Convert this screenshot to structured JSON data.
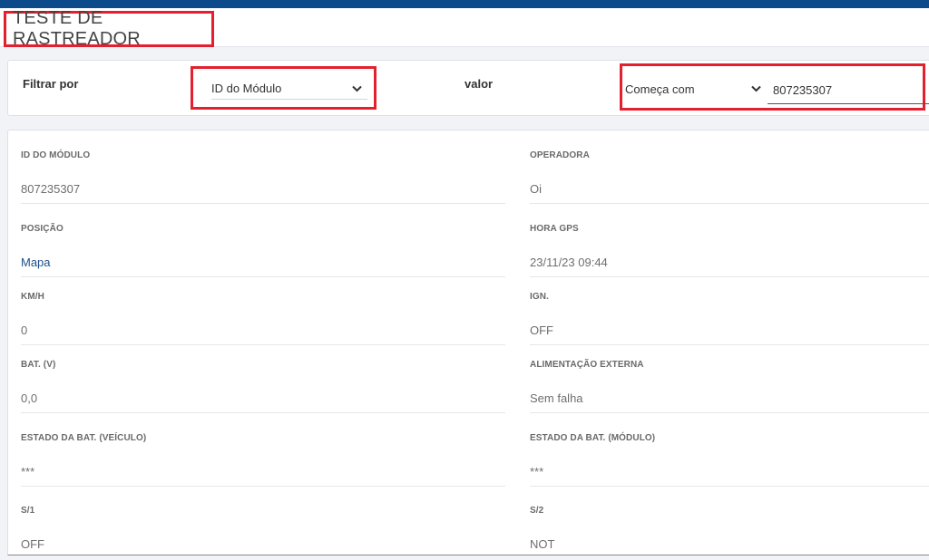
{
  "header": {
    "title": "TESTE DE RASTREADOR"
  },
  "filter": {
    "filter_label": "Filtrar por",
    "filter_select": "ID do Módulo",
    "value_label": "valor",
    "match_select": "Começa com",
    "value_input": "807235307"
  },
  "details": {
    "module_id": {
      "label": "ID DO MÓDULO",
      "value": "807235307"
    },
    "carrier": {
      "label": "OPERADORA",
      "value": "Oi"
    },
    "position": {
      "label": "POSIÇÃO",
      "value": "Mapa"
    },
    "gps_time": {
      "label": "HORA GPS",
      "value": "23/11/23 09:44"
    },
    "speed": {
      "label": "KM/H",
      "value": "0"
    },
    "ignition": {
      "label": "IGN.",
      "value": "OFF"
    },
    "battery": {
      "label": "BAT. (V)",
      "value": "0,0"
    },
    "external_power": {
      "label": "ALIMENTAÇÃO EXTERNA",
      "value": "Sem falha"
    },
    "vehicle_battery_state": {
      "label": "ESTADO DA BAT. (VEÍCULO)",
      "value": "***"
    },
    "module_battery_state": {
      "label": "ESTADO DA BAT. (MÓDULO)",
      "value": "***"
    },
    "s1": {
      "label": "S/1",
      "value": "OFF"
    },
    "s2": {
      "label": "S/2",
      "value": "NOT"
    }
  },
  "colors": {
    "topbar": "#0d4a8b",
    "highlight": "#e4202e",
    "link": "#1f4f8c"
  }
}
